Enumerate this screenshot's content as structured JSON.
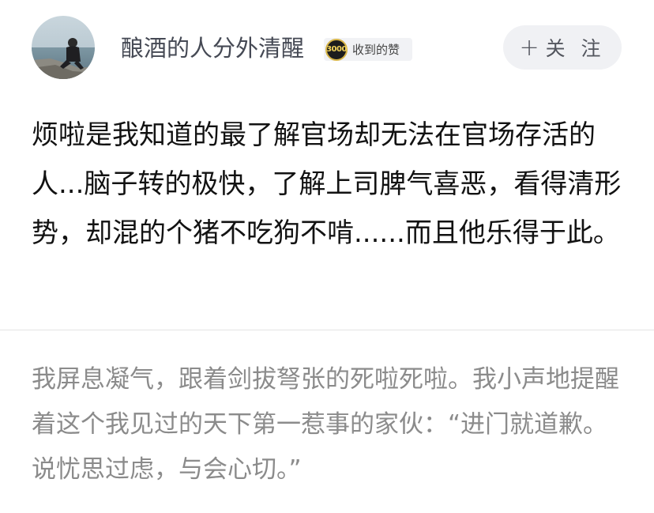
{
  "author": {
    "name": "酿酒的人分外清醒",
    "badge_count": "3000",
    "badge_label": "收到的赞"
  },
  "follow_button": {
    "icon": "plus-icon",
    "label": "关 注"
  },
  "answer": {
    "text": "烦啦是我知道的最了解官场却无法在官场存活的人...脑子转的极快，了解上司脾气喜恶，看得清形势，却混的个猪不吃狗不啃......而且他乐得于此。"
  },
  "quote": {
    "text": "我屏息凝气，跟着剑拔弩张的死啦死啦。我小声地提醒着这个我见过的天下第一惹事的家伙：“进门就道歉。说忧思过虑，与会心切。”"
  },
  "colors": {
    "badge_gold": "#d8b64a",
    "follow_bg": "#f0f1f4",
    "quote_text": "#8b8b8b"
  }
}
